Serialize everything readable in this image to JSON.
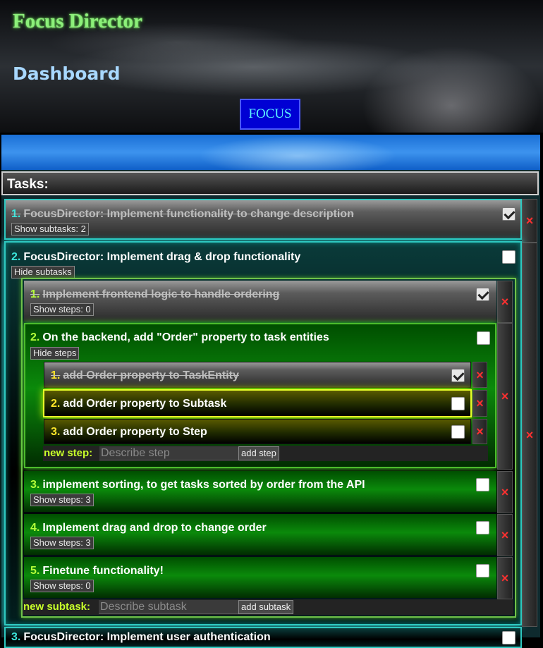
{
  "header": {
    "app_title": "Focus Director",
    "page_title": "Dashboard",
    "focus_button": "FOCUS"
  },
  "tasks_header": "Tasks:",
  "tasks": [
    {
      "num": "1.",
      "title": "FocusDirector: Implement functionality to change description",
      "done": true,
      "toggle_label": "Show subtasks: 2"
    },
    {
      "num": "2.",
      "title": "FocusDirector: Implement drag & drop functionality",
      "done": false,
      "toggle_label": "Hide subtasks",
      "subtasks": [
        {
          "num": "1.",
          "title": "Implement frontend logic to handle ordering",
          "done": true,
          "toggle_label": "Show steps: 0"
        },
        {
          "num": "2.",
          "title": "On the backend, add \"Order\" property to task entities",
          "done": false,
          "toggle_label": "Hide steps",
          "steps": [
            {
              "num": "1.",
              "title": "add Order property to TaskEntity",
              "done": true
            },
            {
              "num": "2.",
              "title": "add Order property to Subtask",
              "done": false
            },
            {
              "num": "3.",
              "title": "add Order property to Step",
              "done": false
            }
          ],
          "new_step": {
            "label": "new step:",
            "placeholder": "Describe step",
            "button": "add step"
          }
        },
        {
          "num": "3.",
          "title": "implement sorting, to get tasks sorted by order from the API",
          "done": false,
          "toggle_label": "Show steps: 3"
        },
        {
          "num": "4.",
          "title": "Implement drag and drop to change order",
          "done": false,
          "toggle_label": "Show steps: 3"
        },
        {
          "num": "5.",
          "title": "Finetune functionality!",
          "done": false,
          "toggle_label": "Show steps: 0"
        }
      ],
      "new_subtask": {
        "label": "new subtask:",
        "placeholder": "Describe subtask",
        "button": "add subtask"
      }
    },
    {
      "num": "3.",
      "title": "FocusDirector: Implement user authentication",
      "done": false
    }
  ],
  "delete_icon": "×",
  "colors": {
    "title_green": "#8cf07a",
    "dashboard_blue": "#a8d8ff",
    "cyan_number": "#3ce6dc",
    "lime_number": "#b5ff3a",
    "yellow_number": "#ffe62a",
    "delete_red": "#ff3030"
  }
}
